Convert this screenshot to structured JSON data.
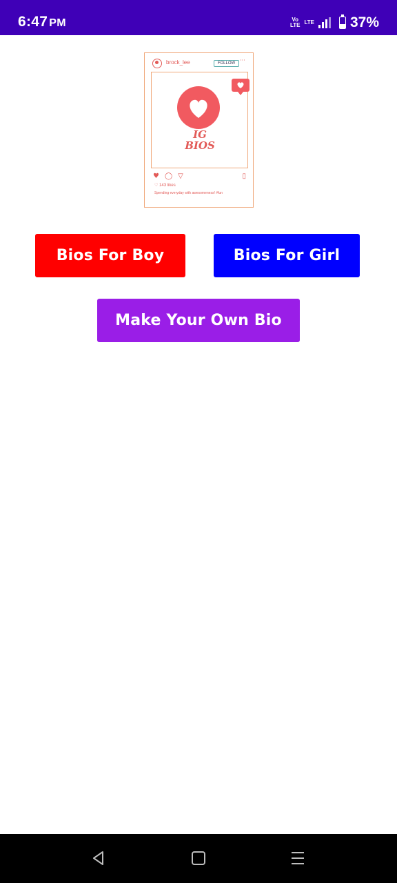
{
  "status_bar": {
    "time": "6:47",
    "ampm": "PM",
    "volte_top": "Vo",
    "volte_bottom": "LTE",
    "lte_top": "LTE",
    "lte_bottom": "",
    "battery_percent": "37%",
    "battery_level": 0.37,
    "background_color": "#3f00b7"
  },
  "hero": {
    "username": "brock_lee",
    "follow_label": "FOLLOW",
    "logo_line1": "IG",
    "logo_line2": "BIOS",
    "likes": "♡ 143 likes",
    "caption": "Spending everyday with awesomeness! #fun"
  },
  "buttons": {
    "boy_label": "Bios For Boy",
    "girl_label": "Bios For Girl",
    "own_label": "Make Your Own Bio",
    "boy_color": "#ff0000",
    "girl_color": "#0000ff",
    "own_color": "#9a1ee7"
  },
  "nav_bar": {
    "icons": [
      "back-icon",
      "home-icon",
      "menu-icon"
    ]
  }
}
